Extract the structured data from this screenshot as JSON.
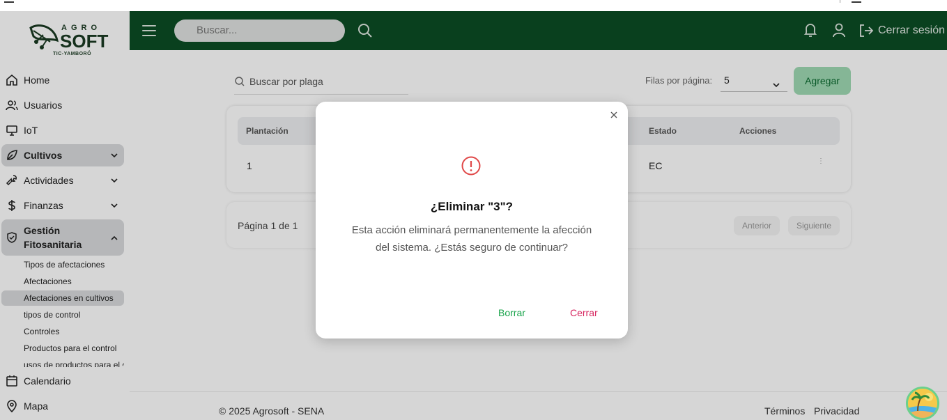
{
  "brand": {
    "top": "AGRO",
    "main": "SOFT",
    "sub": "TIC-YAMBORÓ"
  },
  "sidebar": {
    "items": [
      {
        "label": "Home"
      },
      {
        "label": "Usuarios"
      },
      {
        "label": "IoT"
      },
      {
        "label": "Cultivos"
      },
      {
        "label": "Actividades"
      },
      {
        "label": "Finanzas"
      },
      {
        "label": "Gestión Fitosanitaria"
      },
      {
        "label": "Calendario"
      },
      {
        "label": "Mapa"
      }
    ],
    "subitems": [
      {
        "label": "Tipos de afectaciones"
      },
      {
        "label": "Afectaciones"
      },
      {
        "label": "Afectaciones en cultivos"
      },
      {
        "label": "tipos de control"
      },
      {
        "label": "Controles"
      },
      {
        "label": "Productos para el control"
      },
      {
        "label": "usos de productos para el control"
      }
    ]
  },
  "header": {
    "search_placeholder": "Buscar...",
    "logout": "Cerrar sesión"
  },
  "main": {
    "search_placeholder": "Buscar por plaga",
    "rows_label": "Filas por página:",
    "rows_value": "5",
    "add_button": "Agregar",
    "columns": [
      "Plantación",
      "Estado",
      "Acciones"
    ],
    "rows": [
      {
        "plantacion": "1",
        "estado": "EC"
      }
    ],
    "page_info": "Página 1 de 1",
    "prev": "Anterior",
    "next": "Siguiente"
  },
  "footer": {
    "copyright": "© 2025 Agrosoft - SENA",
    "terms": "Términos",
    "privacy": "Privacidad"
  },
  "modal": {
    "title": "¿Eliminar \"3\"?",
    "message": "Esta acción eliminará permanentemente la afección del sistema. ¿Estás seguro de continuar?",
    "confirm": "Borrar",
    "cancel": "Cerrar"
  },
  "colors": {
    "header": "#0b4d24",
    "accent": "#18a34a",
    "danger": "#d6245e"
  }
}
